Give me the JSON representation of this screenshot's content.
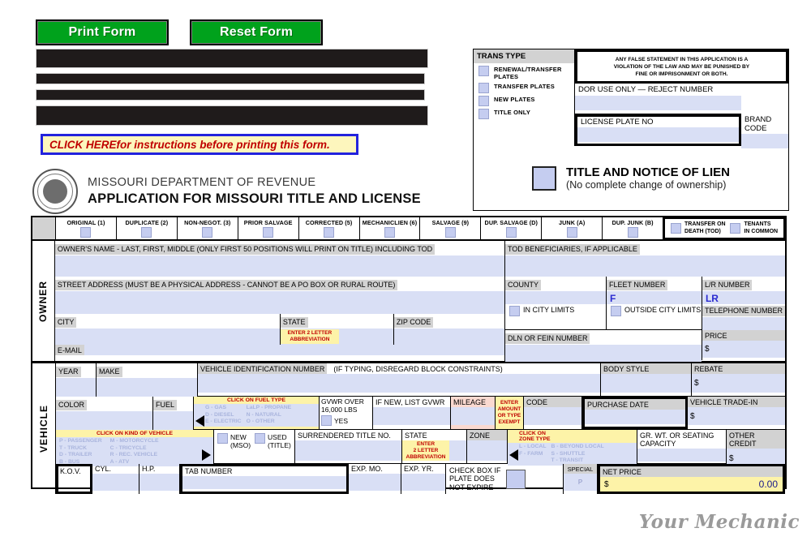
{
  "toolbar": {
    "print_label": "Print Form",
    "reset_label": "Reset Form"
  },
  "instructions_banner": {
    "emphasis": "CLICK HERE",
    "rest": " for instructions before printing this form."
  },
  "agency": {
    "line1": "MISSOURI DEPARTMENT OF REVENUE",
    "line2": "APPLICATION FOR MISSOURI TITLE AND LICENSE",
    "seal_icon": "state-seal-icon"
  },
  "trans_type": {
    "title": "TRANS TYPE",
    "options": [
      "RENEWAL/TRANSFER PLATES",
      "TRANSFER PLATES",
      "NEW PLATES",
      "TITLE ONLY"
    ]
  },
  "warning": {
    "line1": "ANY FALSE STATEMENT IN THIS APPLICATION IS A",
    "line2": "VIOLATION OF THE LAW AND MAY BE PUNISHED BY",
    "line3": "FINE OR IMPRISONMENT OR BOTH."
  },
  "dor_block": {
    "reject_label": "DOR USE ONLY — REJECT NUMBER",
    "license_plate_label": "LICENSE PLATE NO",
    "brand_code_label": "BRAND CODE"
  },
  "lien": {
    "title": "TITLE AND NOTICE OF LIEN",
    "subtitle": "(No complete change of ownership)"
  },
  "type_strip": {
    "cells": [
      "ORIGINAL (1)",
      "DUPLICATE (2)",
      "NON-NEGOT. (3)",
      "PRIOR SALVAGE",
      "CORRECTED (5)",
      "MECHANICLIEN (6)",
      "SALVAGE (9)",
      "DUP. SALVAGE (D)",
      "JUNK (A)",
      "DUP. JUNK (B)"
    ],
    "boxed": [
      {
        "l1": "TRANSFER ON",
        "l2": "DEATH (TOD)"
      },
      {
        "l1": "TENANTS",
        "l2": "IN COMMON"
      }
    ]
  },
  "owner": {
    "section_label": "OWNER",
    "name_label": "OWNER'S NAME - LAST, FIRST, MIDDLE (ONLY FIRST 50 POSITIONS WILL PRINT ON TITLE) INCLUDING TOD",
    "street_label": "STREET ADDRESS (MUST BE A PHYSICAL ADDRESS - CANNOT BE A PO BOX OR RURAL ROUTE)",
    "city_label": "CITY",
    "state_label": "STATE",
    "state_hint1": "ENTER 2 LETTER",
    "state_hint2": "ABBREVIATION",
    "zip_label": "ZIP CODE",
    "email_label": "E-MAIL",
    "tod_label": "TOD BENEFICIARIES, IF APPLICABLE",
    "county_label": "COUNTY",
    "fleet_label": "FLEET NUMBER",
    "fleet_prefix": "F",
    "lr_label": "L/R NUMBER",
    "lr_prefix": "LR",
    "in_city_label": "IN CITY LIMITS",
    "outside_city_label": "OUTSIDE CITY LIMITS",
    "telephone_label": "TELEPHONE NUMBER",
    "dln_label": "DLN OR FEIN NUMBER",
    "price_label": "PRICE",
    "price_symbol": "$"
  },
  "vehicle": {
    "section_label": "VEHICLE",
    "year_label": "YEAR",
    "make_label": "MAKE",
    "vin_label": "VEHICLE IDENTIFICATION NUMBER",
    "vin_note": "(IF TYPING, DISREGARD BLOCK CONSTRAINTS)",
    "body_style_label": "BODY STYLE",
    "rebate_label": "REBATE",
    "rebate_symbol": "$",
    "color_label": "COLOR",
    "fuel_label": "FUEL",
    "fuel_picker_title": "CLICK ON FUEL TYPE",
    "fuel_col1": [
      "G - GAS",
      "D - DIESEL",
      "E - ELECTRIC"
    ],
    "fuel_col2": [
      "LaLP - PROPANE",
      "N - NATURAL",
      "O - OTHER"
    ],
    "gvwr_over_l1": "GVWR OVER",
    "gvwr_over_l2": "16,000 LBS",
    "gvwr_yes": "YES",
    "if_new_gvwr_label": "IF NEW, LIST GVWR",
    "mileage_label": "MILEAGE",
    "mileage_hint": [
      "ENTER",
      "AMOUNT",
      "OR TYPE",
      "EXEMPT"
    ],
    "code_label": "CODE",
    "purchase_date_label": "PURCHASE DATE",
    "trade_in_label": "VEHICLE TRADE-IN",
    "trade_in_symbol": "$",
    "kov_picker_title": "CLICK ON KIND OF VEHICLE",
    "kov_col1": [
      "P - PASSENGER",
      "T - TRUCK",
      "D - TRAILER",
      "B - BUS"
    ],
    "kov_col2": [
      "M - MOTORCYCLE",
      "C - TRICYCLE",
      "R - REC. VEHICLE",
      "A - ATV"
    ],
    "new_label": "NEW",
    "new_sub": "(MSO)",
    "used_label": "USED",
    "used_sub": "(TITLE)",
    "surrendered_label": "SURRENDERED TITLE NO.",
    "state_label": "STATE",
    "state_hint": [
      "ENTER",
      "2 LETTER",
      "ABBREVIATION"
    ],
    "zone_label": "ZONE",
    "zone_picker_title": [
      "CLICK ON",
      "ZONE TYPE"
    ],
    "zone_col1": [
      "L - LOCAL",
      "F - FARM"
    ],
    "zone_col2": [
      "B - BEYOND LOCAL",
      "S - SHUTTLE",
      "T - TRANSIT"
    ],
    "gr_wt_l1": "GR. WT. OR SEATING",
    "gr_wt_l2": "CAPACITY",
    "other_credit_label": "OTHER CREDIT",
    "other_credit_symbol": "$",
    "kov_label": "K.O.V.",
    "cyl_label": "CYL.",
    "hp_label": "H.P.",
    "tab_number_label": "TAB NUMBER",
    "exp_mo_label": "EXP. MO.",
    "exp_yr_label": "EXP. YR.",
    "no_expire_l1": "CHECK BOX IF",
    "no_expire_l2": "PLATE DOES",
    "no_expire_l3": "NOT EXPIRE",
    "special_label": "SPECIAL",
    "special_prefix": "P",
    "net_price_label": "NET PRICE",
    "net_price_symbol": "$",
    "net_price_value": "0.00"
  },
  "watermark": "Your Mechanic",
  "colors": {
    "button_green": "#00a21c",
    "field_blue": "#d9dff5",
    "label_gray": "#d2d2d2",
    "hint_yellow": "#fdf3a8",
    "alert_red": "#c00000",
    "link_border_blue": "#2222dd"
  }
}
